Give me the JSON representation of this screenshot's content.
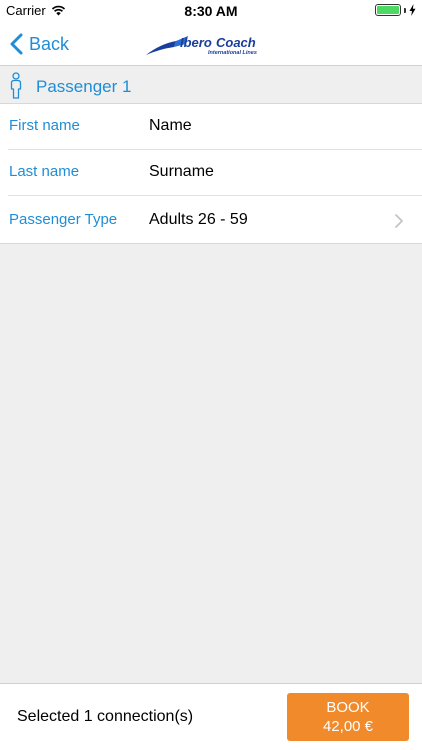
{
  "status_bar": {
    "carrier": "Carrier",
    "time": "8:30 AM",
    "battery_level": 1.0
  },
  "nav": {
    "back_label": "Back",
    "logo": {
      "name_part1": "Ibero",
      "name_part2": "Coach",
      "tagline": "International Lines",
      "color": "#1a3e9c"
    }
  },
  "section": {
    "title": "Passenger 1",
    "icon": "person-icon"
  },
  "form": {
    "rows": [
      {
        "label": "First name",
        "value": "Name"
      },
      {
        "label": "Last name",
        "value": "Surname"
      },
      {
        "label": "Passenger Type",
        "value": "Adults 26 - 59",
        "icon": "chevron-right-icon"
      }
    ]
  },
  "footer": {
    "selected_text": "Selected 1 connection(s)",
    "book_label": "BOOK",
    "book_price": "42,00 €"
  },
  "colors": {
    "accent": "#1f8ed6",
    "book_button": "#f08a2b",
    "background": "#efefef"
  }
}
